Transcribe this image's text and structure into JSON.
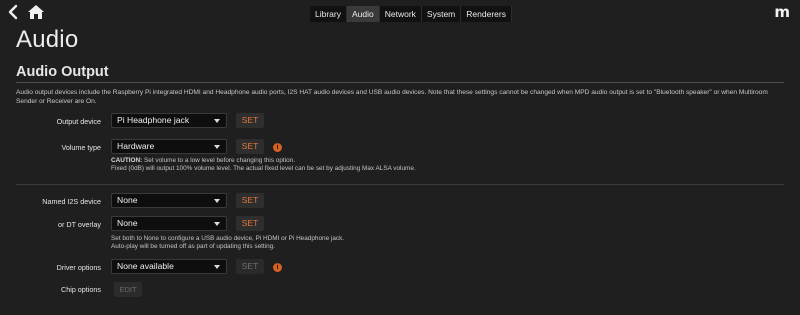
{
  "nav": {
    "tabs": [
      {
        "label": "Library"
      },
      {
        "label": "Audio",
        "active": true
      },
      {
        "label": "Network"
      },
      {
        "label": "System"
      },
      {
        "label": "Renderers"
      }
    ],
    "logo": "m"
  },
  "page_title": "Audio",
  "section_title": "Audio Output",
  "description": "Audio output devices include the Raspberry Pi integrated HDMI and Headphone audio ports, I2S HAT audio devices and USB audio devices. Note that these settings cannot be changed when MPD audio output is set to \"Bluetooth speaker\" or when Multiroom Sender or Receiver are On.",
  "output_device": {
    "label": "Output device",
    "value": "Pi Headphone jack",
    "button": "SET"
  },
  "volume_type": {
    "label": "Volume type",
    "value": "Hardware",
    "button": "SET",
    "help_caution_label": "CAUTION:",
    "help_caution_text": " Set volume to a low level before changing this option.",
    "help_line2": "Fixed (0dB) will output 100% volume level. The actual fixed level can be set by adjusting Max ALSA volume."
  },
  "named_i2s": {
    "label": "Named I2S device",
    "value": "None",
    "button": "SET"
  },
  "dt_overlay": {
    "label": "or DT overlay",
    "value": "None",
    "button": "SET",
    "help_line1": "Set both to None to configure a USB audio device, Pi HDMI or Pi Headphone jack.",
    "help_line2": "Auto-play will be turned off as part of updating this setting."
  },
  "driver_options": {
    "label": "Driver options",
    "value": "None available",
    "button": "SET"
  },
  "chip_options": {
    "label": "Chip options",
    "button": "EDIT"
  },
  "colors": {
    "background": "#1f1f1f",
    "accent": "#e2763a",
    "info_badge": "#d8621f"
  },
  "icons": [
    "chevron-left-icon",
    "home-icon",
    "info-icon",
    "caret-down-icon"
  ]
}
